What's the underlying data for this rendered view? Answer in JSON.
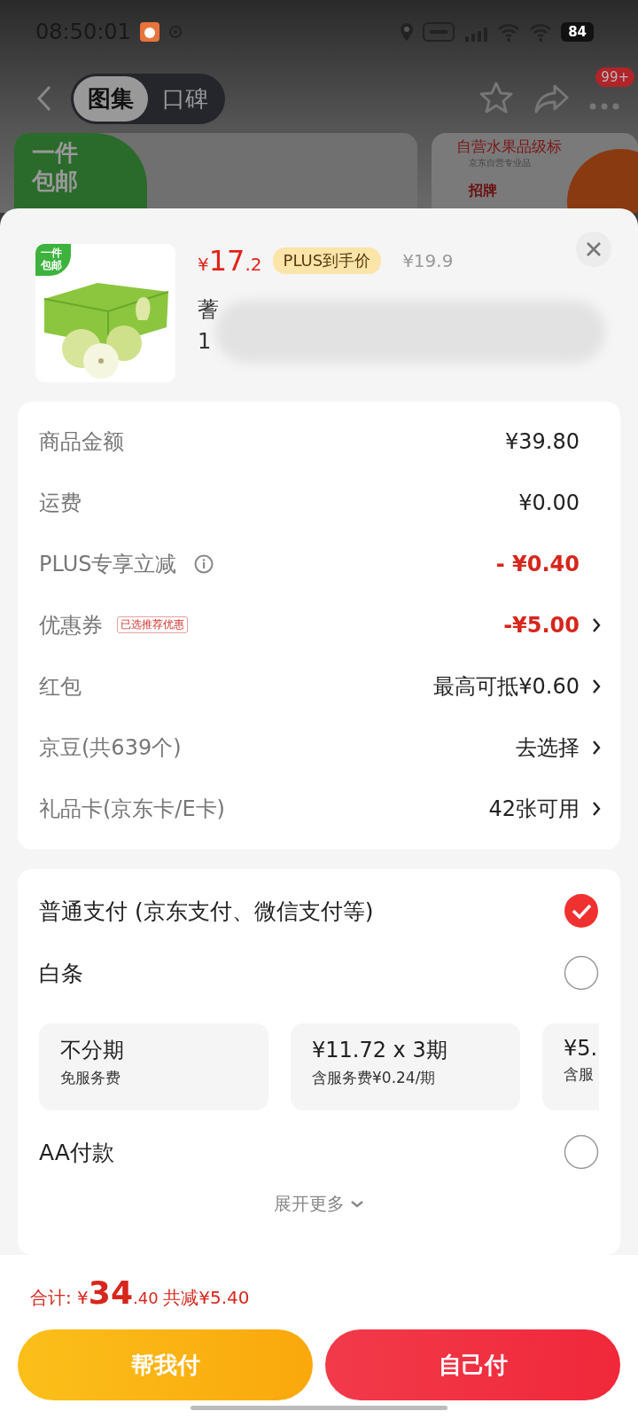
{
  "status_bar": {
    "time": "08:50:01",
    "battery": "84"
  },
  "nav": {
    "tabs": [
      {
        "label": "图集",
        "selected": true
      },
      {
        "label": "口碑",
        "selected": false
      }
    ],
    "badge": "99+"
  },
  "backdrop": {
    "left_badge": [
      "一件",
      "包邮"
    ],
    "right_title": "自营水果品级标",
    "right_subtitle": "京东自营专业品",
    "right_tag": "招牌"
  },
  "product": {
    "currency": "¥",
    "price_main": "17",
    "price_decimal": ".2",
    "plus_label": "PLUS到手价",
    "original_price": "¥19.9",
    "image_badge": [
      "一件",
      "包邮"
    ],
    "title_lines": [
      "蓍",
      "1"
    ]
  },
  "fees": [
    {
      "kind": "plain",
      "label": "商品金额",
      "value": "¥39.80",
      "highlight": false,
      "arrow": false
    },
    {
      "kind": "plain",
      "label": "运费",
      "value": "¥0.00",
      "highlight": false,
      "arrow": false
    },
    {
      "kind": "info",
      "label": "PLUS专享立减",
      "value": "- ¥0.40",
      "highlight": true,
      "arrow": false
    },
    {
      "kind": "tag",
      "label": "优惠券",
      "tag": "已选推荐优惠",
      "value": "-¥5.00",
      "highlight": true,
      "arrow": true
    },
    {
      "kind": "plain",
      "label": "红包",
      "value": "最高可抵¥0.60",
      "highlight": false,
      "arrow": true
    },
    {
      "kind": "plain",
      "label": "京豆(共639个)",
      "value": "去选择",
      "highlight": false,
      "arrow": true
    },
    {
      "kind": "plain",
      "label": "礼品卡(京东卡/E卡)",
      "value": "42张可用",
      "highlight": false,
      "arrow": true
    }
  ],
  "payment": {
    "methods": [
      {
        "label": "普通支付 (京东支付、微信支付等)",
        "selected": true
      },
      {
        "label": "白条",
        "selected": false,
        "plans": [
          {
            "title": "不分期",
            "subtitle": "免服务费"
          },
          {
            "title": "¥11.72 x 3期",
            "subtitle": "含服务费¥0.24/期"
          },
          {
            "title": "¥5.",
            "subtitle": "含服"
          }
        ]
      },
      {
        "label": "AA付款",
        "selected": false
      }
    ],
    "expand": "展开更多"
  },
  "footer": {
    "total_label": "合计:",
    "currency": "¥",
    "total_int": "34",
    "total_dec": ".40",
    "saving": "共减¥5.40",
    "buttons": [
      {
        "kind": "secondary",
        "label": "帮我付"
      },
      {
        "kind": "primary",
        "label": "自己付"
      }
    ]
  }
}
